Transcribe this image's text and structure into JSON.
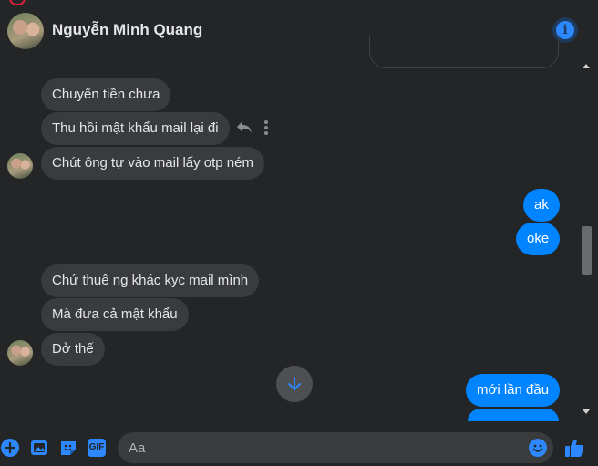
{
  "header": {
    "contact_name": "Nguyễn Minh Quang",
    "info_icon": "info-icon"
  },
  "messages": {
    "incoming_group_1": [
      "Chuyển tiền chưa",
      "Thu hồi mật khẩu mail lại đi",
      "Chút ông tự vào mail lấy otp ném"
    ],
    "outgoing_group_1": [
      "ak",
      "oke"
    ],
    "incoming_group_2": [
      "Chứ thuê ng khác kyc mail mình",
      "Mà đưa cả mật khẩu",
      "Dở thế"
    ],
    "outgoing_group_2": [
      "mới lần đầu"
    ]
  },
  "composer": {
    "placeholder": "Aa",
    "tools": [
      "plus-icon",
      "image-icon",
      "sticker-icon",
      "gif-icon"
    ],
    "gif_label": "GIF"
  },
  "colors": {
    "background": "#242526",
    "incoming_bubble": "#3a3b3c",
    "outgoing_bubble": "#0084ff",
    "accent": "#2d88ff"
  }
}
